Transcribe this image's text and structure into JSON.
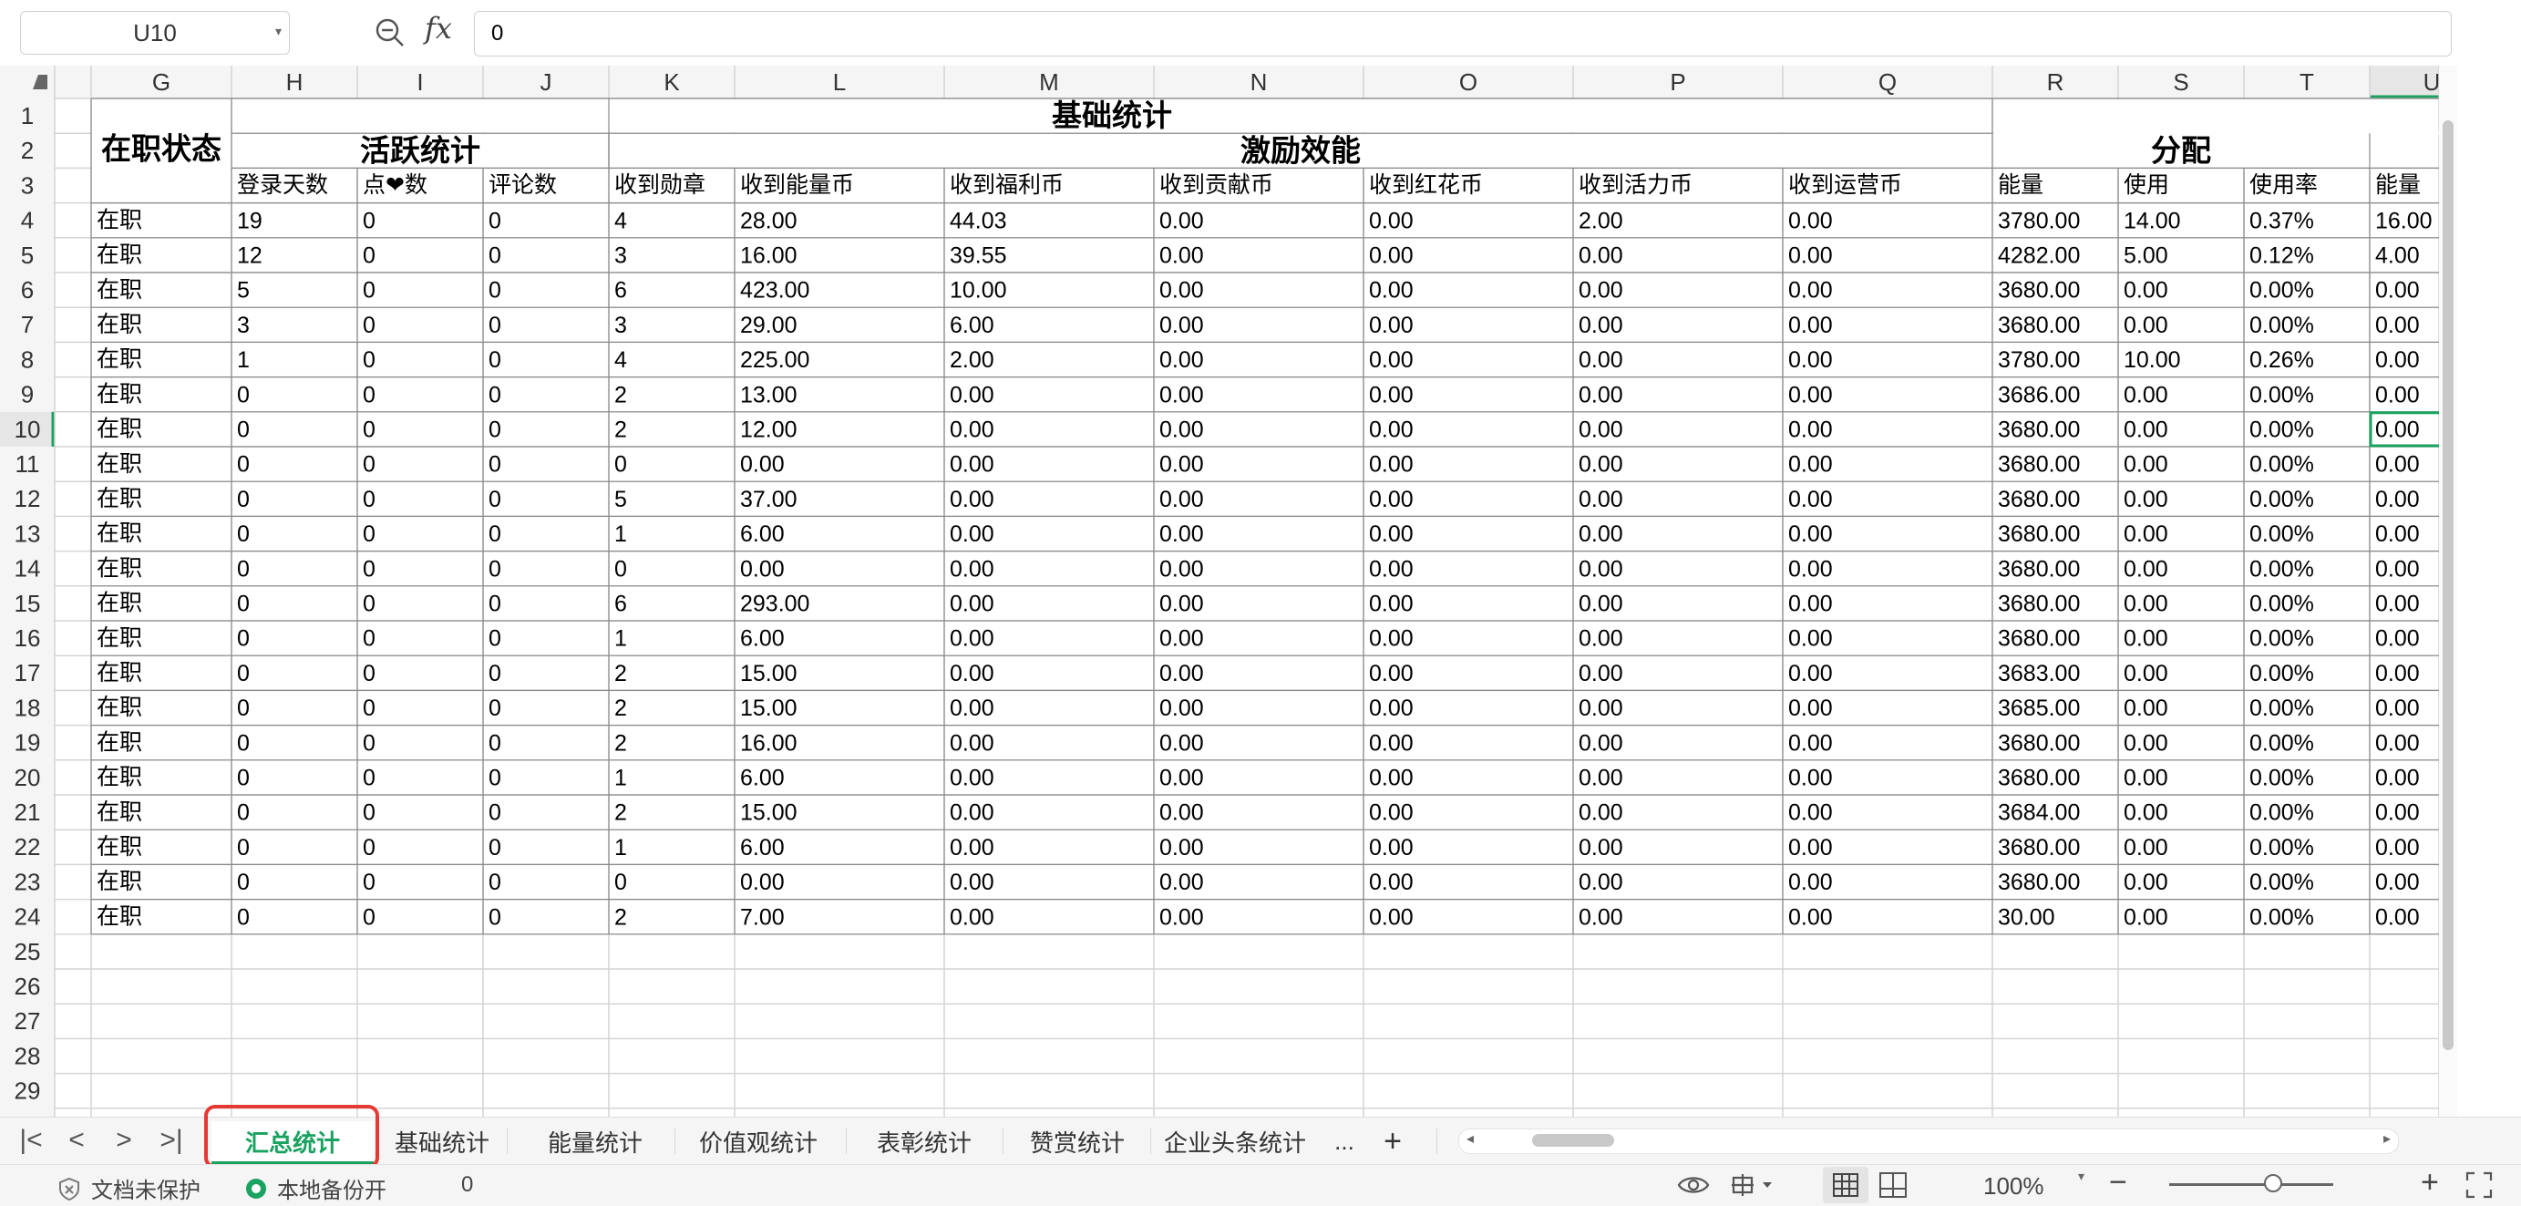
{
  "formula_bar": {
    "name_box": "U10",
    "formula_value": "0",
    "fx_label": "fx"
  },
  "columns": [
    "G",
    "H",
    "I",
    "J",
    "K",
    "L",
    "M",
    "N",
    "O",
    "P",
    "Q",
    "R",
    "S",
    "T",
    "U"
  ],
  "rows": [
    "1",
    "2",
    "3",
    "4",
    "5",
    "6",
    "7",
    "8",
    "9",
    "10",
    "11",
    "12",
    "13",
    "14",
    "15",
    "16",
    "17",
    "18",
    "19",
    "20",
    "21",
    "22",
    "23",
    "24",
    "25",
    "26",
    "27",
    "28",
    "29"
  ],
  "headers": {
    "status": "在职状态",
    "basic_stats": "基础统计",
    "activity_stats": "活跃统计",
    "incentive": "激励效能",
    "allocation": "分配",
    "sub": [
      "登录天数",
      "点❤数",
      "评论数",
      "收到勋章",
      "收到能量币",
      "收到福利币",
      "收到贡献币",
      "收到红花币",
      "收到活力币",
      "收到运营币",
      "能量",
      "使用",
      "使用率",
      "能量"
    ]
  },
  "table": [
    [
      "在职",
      "19",
      "0",
      "0",
      "4",
      "28.00",
      "44.03",
      "0.00",
      "0.00",
      "2.00",
      "0.00",
      "3780.00",
      "14.00",
      "0.37%",
      "16.00"
    ],
    [
      "在职",
      "12",
      "0",
      "0",
      "3",
      "16.00",
      "39.55",
      "0.00",
      "0.00",
      "0.00",
      "0.00",
      "4282.00",
      "5.00",
      "0.12%",
      "4.00"
    ],
    [
      "在职",
      "5",
      "0",
      "0",
      "6",
      "423.00",
      "10.00",
      "0.00",
      "0.00",
      "0.00",
      "0.00",
      "3680.00",
      "0.00",
      "0.00%",
      "0.00"
    ],
    [
      "在职",
      "3",
      "0",
      "0",
      "3",
      "29.00",
      "6.00",
      "0.00",
      "0.00",
      "0.00",
      "0.00",
      "3680.00",
      "0.00",
      "0.00%",
      "0.00"
    ],
    [
      "在职",
      "1",
      "0",
      "0",
      "4",
      "225.00",
      "2.00",
      "0.00",
      "0.00",
      "0.00",
      "0.00",
      "3780.00",
      "10.00",
      "0.26%",
      "0.00"
    ],
    [
      "在职",
      "0",
      "0",
      "0",
      "2",
      "13.00",
      "0.00",
      "0.00",
      "0.00",
      "0.00",
      "0.00",
      "3686.00",
      "0.00",
      "0.00%",
      "0.00"
    ],
    [
      "在职",
      "0",
      "0",
      "0",
      "2",
      "12.00",
      "0.00",
      "0.00",
      "0.00",
      "0.00",
      "0.00",
      "3680.00",
      "0.00",
      "0.00%",
      "0.00"
    ],
    [
      "在职",
      "0",
      "0",
      "0",
      "0",
      "0.00",
      "0.00",
      "0.00",
      "0.00",
      "0.00",
      "0.00",
      "3680.00",
      "0.00",
      "0.00%",
      "0.00"
    ],
    [
      "在职",
      "0",
      "0",
      "0",
      "5",
      "37.00",
      "0.00",
      "0.00",
      "0.00",
      "0.00",
      "0.00",
      "3680.00",
      "0.00",
      "0.00%",
      "0.00"
    ],
    [
      "在职",
      "0",
      "0",
      "0",
      "1",
      "6.00",
      "0.00",
      "0.00",
      "0.00",
      "0.00",
      "0.00",
      "3680.00",
      "0.00",
      "0.00%",
      "0.00"
    ],
    [
      "在职",
      "0",
      "0",
      "0",
      "0",
      "0.00",
      "0.00",
      "0.00",
      "0.00",
      "0.00",
      "0.00",
      "3680.00",
      "0.00",
      "0.00%",
      "0.00"
    ],
    [
      "在职",
      "0",
      "0",
      "0",
      "6",
      "293.00",
      "0.00",
      "0.00",
      "0.00",
      "0.00",
      "0.00",
      "3680.00",
      "0.00",
      "0.00%",
      "0.00"
    ],
    [
      "在职",
      "0",
      "0",
      "0",
      "1",
      "6.00",
      "0.00",
      "0.00",
      "0.00",
      "0.00",
      "0.00",
      "3680.00",
      "0.00",
      "0.00%",
      "0.00"
    ],
    [
      "在职",
      "0",
      "0",
      "0",
      "2",
      "15.00",
      "0.00",
      "0.00",
      "0.00",
      "0.00",
      "0.00",
      "3683.00",
      "0.00",
      "0.00%",
      "0.00"
    ],
    [
      "在职",
      "0",
      "0",
      "0",
      "2",
      "15.00",
      "0.00",
      "0.00",
      "0.00",
      "0.00",
      "0.00",
      "3685.00",
      "0.00",
      "0.00%",
      "0.00"
    ],
    [
      "在职",
      "0",
      "0",
      "0",
      "2",
      "16.00",
      "0.00",
      "0.00",
      "0.00",
      "0.00",
      "0.00",
      "3680.00",
      "0.00",
      "0.00%",
      "0.00"
    ],
    [
      "在职",
      "0",
      "0",
      "0",
      "1",
      "6.00",
      "0.00",
      "0.00",
      "0.00",
      "0.00",
      "0.00",
      "3680.00",
      "0.00",
      "0.00%",
      "0.00"
    ],
    [
      "在职",
      "0",
      "0",
      "0",
      "2",
      "15.00",
      "0.00",
      "0.00",
      "0.00",
      "0.00",
      "0.00",
      "3684.00",
      "0.00",
      "0.00%",
      "0.00"
    ],
    [
      "在职",
      "0",
      "0",
      "0",
      "1",
      "6.00",
      "0.00",
      "0.00",
      "0.00",
      "0.00",
      "0.00",
      "3680.00",
      "0.00",
      "0.00%",
      "0.00"
    ],
    [
      "在职",
      "0",
      "0",
      "0",
      "0",
      "0.00",
      "0.00",
      "0.00",
      "0.00",
      "0.00",
      "0.00",
      "3680.00",
      "0.00",
      "0.00%",
      "0.00"
    ],
    [
      "在职",
      "0",
      "0",
      "0",
      "2",
      "7.00",
      "0.00",
      "0.00",
      "0.00",
      "0.00",
      "0.00",
      "30.00",
      "0.00",
      "0.00%",
      "0.00"
    ]
  ],
  "selected_cell": "U10",
  "tabs": {
    "nav": [
      "|<",
      "<",
      ">",
      ">|"
    ],
    "sheets": [
      "汇总统计",
      "基础统计",
      "能量统计",
      "价值观统计",
      "表彰统计",
      "赞赏统计",
      "企业头条统计"
    ],
    "more": "...",
    "add": "+",
    "active_index": 0
  },
  "status_bar": {
    "protection": "文档未保护",
    "backup": "本地备份开",
    "sum_value": "0",
    "zoom": "100%",
    "zoom_minus": "−",
    "zoom_plus": "+"
  },
  "colors": {
    "accent_green": "#1aa260",
    "highlight_red": "#e53935",
    "grid_line": "#d4d4d4",
    "header_bg": "#f5f5f5"
  }
}
